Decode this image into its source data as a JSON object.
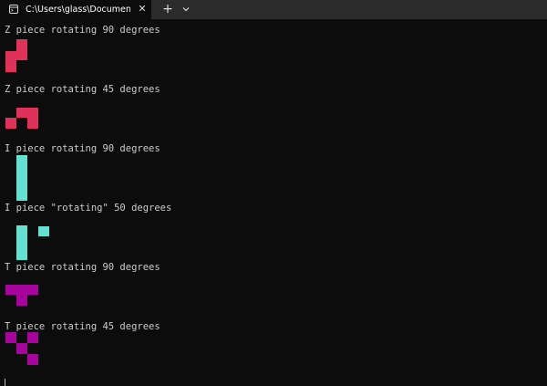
{
  "tab": {
    "title": "C:\\Users\\glass\\Documents\\Re",
    "close_glyph": "✕",
    "icon": "terminal-icon"
  },
  "toolbar": {
    "new_tab_glyph": "+",
    "dropdown_icon": "chevron-down-icon"
  },
  "colors": {
    "z_piece": "#e0315a",
    "i_piece": "#63e0cf",
    "t_piece": "#a6049c",
    "background": "#0c0c0c",
    "text": "#cccccc"
  },
  "output": [
    {
      "text": "Z piece rotating 90 degrees"
    },
    {
      "text": "Z piece rotating 45 degrees"
    },
    {
      "text": "I piece rotating 90 degrees"
    },
    {
      "text": "I piece \"rotating\" 50 degrees"
    },
    {
      "text": "T piece rotating 90 degrees"
    },
    {
      "text": "T piece rotating 45 degrees"
    }
  ]
}
